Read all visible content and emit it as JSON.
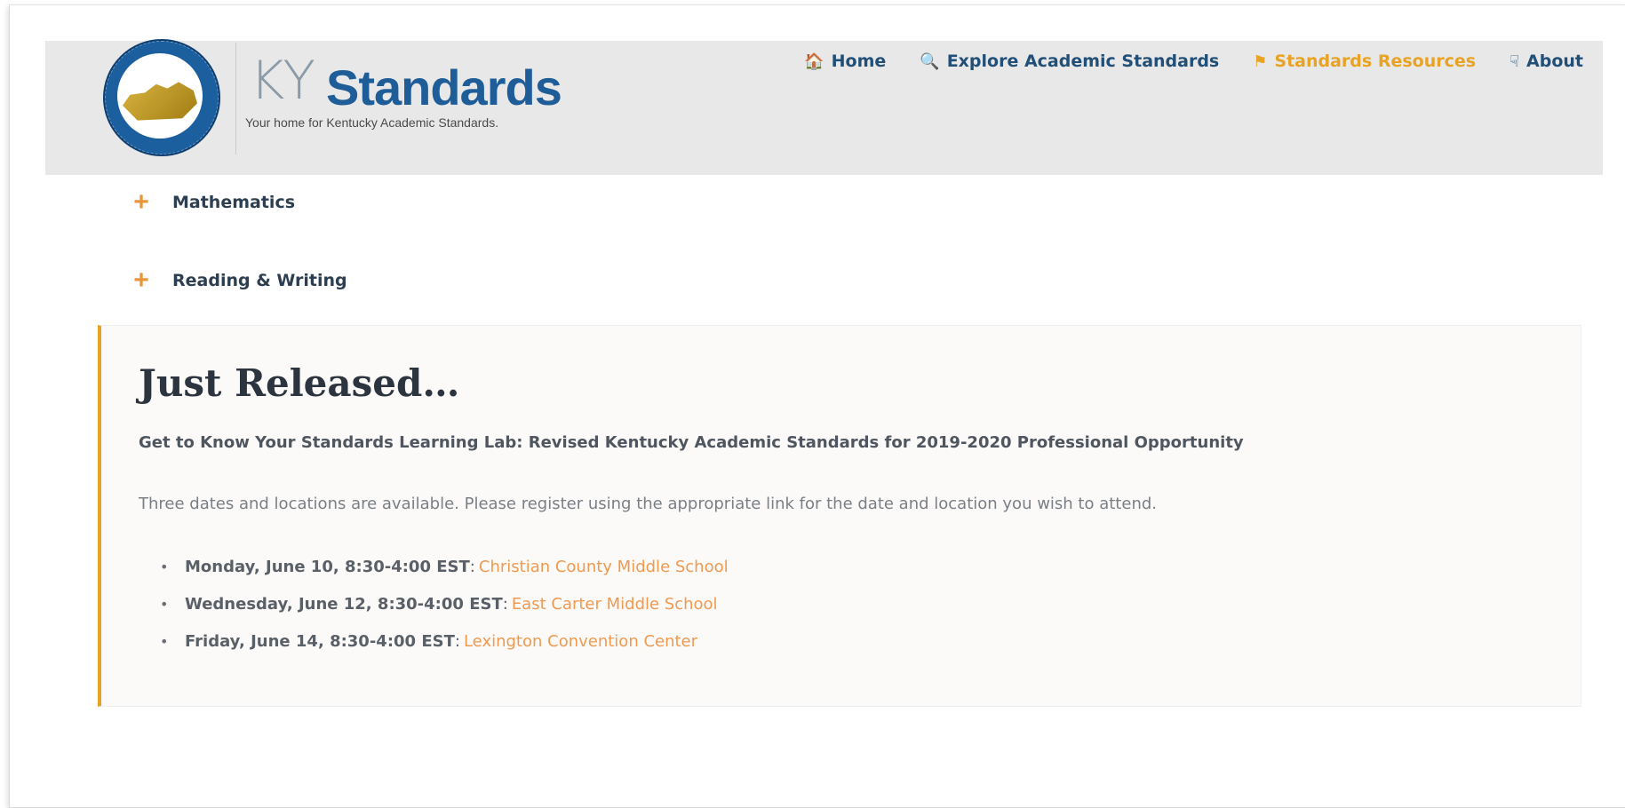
{
  "header": {
    "brand_ky": "KY",
    "brand_standards": "Standards",
    "tagline": "Your home for Kentucky Academic Standards.",
    "logo_icon": "kentucky-department-of-education-seal",
    "nav": [
      {
        "label": "Home",
        "icon": "home-icon",
        "glyph": "🏠"
      },
      {
        "label": "Explore Academic Standards",
        "icon": "magnifier-icon",
        "glyph": "🔍"
      },
      {
        "label": "Standards Resources",
        "icon": "torch-icon",
        "glyph": "⚑",
        "active": true
      },
      {
        "label": "About",
        "icon": "thumbs-icon",
        "glyph": "☟"
      }
    ]
  },
  "accordion": [
    {
      "label": "Mathematics",
      "icon": "plus-icon"
    },
    {
      "label": "Reading & Writing",
      "icon": "plus-icon"
    }
  ],
  "release": {
    "title": "Just Released…",
    "subtitle": "Get to Know Your Standards Learning Lab: Revised Kentucky Academic Standards for 2019-2020 Professional Opportunity",
    "description": "Three dates and locations are available. Please register using the appropriate link for the date and location you wish to attend.",
    "items": [
      {
        "date": "Monday, June 10, 8:30-4:00 EST",
        "location": "Christian County Middle School"
      },
      {
        "date": "Wednesday, June 12, 8:30-4:00 EST",
        "location": "East Carter Middle School"
      },
      {
        "date": "Friday, June 14, 8:30-4:00 EST",
        "location": "Lexington Convention Center"
      }
    ]
  },
  "colors": {
    "accent": "#e8a325",
    "brand_blue": "#1f5d99",
    "link": "#f09a50",
    "header_bg": "#e8e8e8"
  }
}
